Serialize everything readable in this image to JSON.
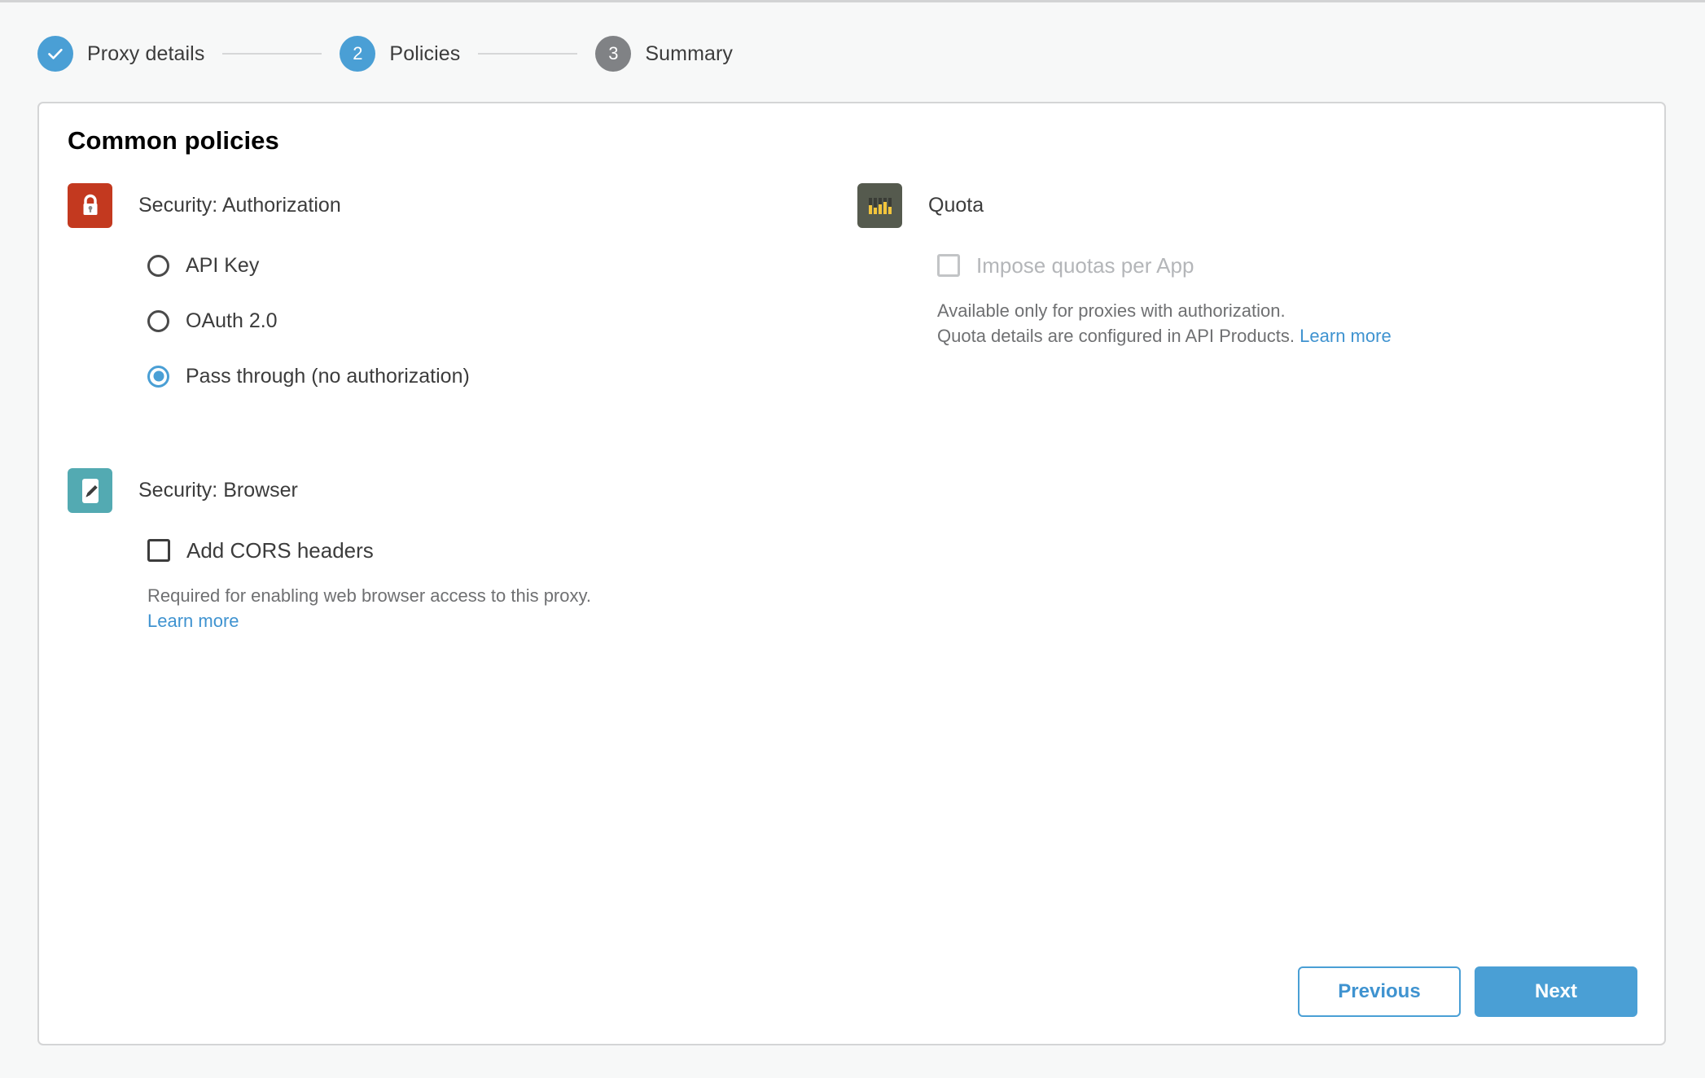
{
  "stepper": {
    "steps": [
      {
        "badge": "check-icon",
        "label": "Proxy details",
        "state": "done"
      },
      {
        "badge": "2",
        "label": "Policies",
        "state": "active"
      },
      {
        "badge": "3",
        "label": "Summary",
        "state": "todo"
      }
    ]
  },
  "card": {
    "title": "Common policies",
    "policies": {
      "authorization": {
        "icon": "lock-icon",
        "name": "Security: Authorization",
        "options": [
          {
            "label": "API Key",
            "selected": false
          },
          {
            "label": "OAuth 2.0",
            "selected": false
          },
          {
            "label": "Pass through (no authorization)",
            "selected": true
          }
        ]
      },
      "browser": {
        "icon": "pencil-icon",
        "name": "Security: Browser",
        "checkbox": {
          "label": "Add CORS headers",
          "checked": false,
          "disabled": false
        },
        "helper_line1": "Required for enabling web browser access to this proxy.",
        "helper_line2": "",
        "link": "Learn more"
      },
      "quota": {
        "icon": "bar-chart-icon",
        "name": "Quota",
        "checkbox": {
          "label": "Impose quotas per App",
          "checked": false,
          "disabled": true
        },
        "helper_line1": "Available only for proxies with authorization.",
        "helper_line2": "Quota details are configured in API Products.",
        "link": "Learn more"
      }
    },
    "footer": {
      "previous_label": "Previous",
      "next_label": "Next"
    }
  },
  "colors": {
    "accent_blue": "#4a9fd5",
    "link_blue": "#3f93d0",
    "lock_red": "#c3391f",
    "quota_olive": "#555a4e",
    "quota_yellow": "#f3c53c",
    "browser_teal": "#53aab2",
    "step_inactive_gray": "#808285",
    "page_background": "#f7f8f8",
    "card_border": "#d4d5d6"
  }
}
